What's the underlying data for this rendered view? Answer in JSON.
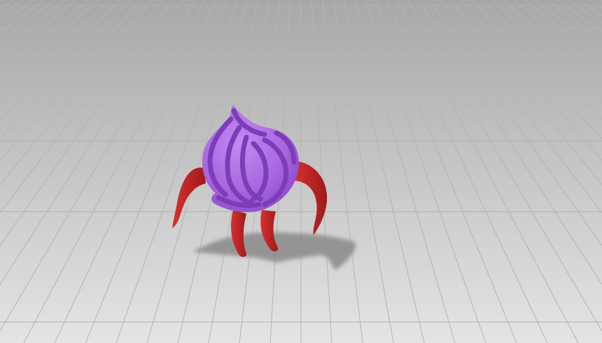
{
  "scene": {
    "background_top": "#a8a8a8",
    "background_bottom": "#e4e4e4",
    "grid_color": "#b4b4b4",
    "character": {
      "name_icon": "onion-creature",
      "body_color": "#a866e0",
      "stripe_color": "#7d3cb8",
      "limb_color": "#d83030",
      "limb_shade_color": "#9e1a1a"
    },
    "shadow_color": "#8a8a8a"
  }
}
